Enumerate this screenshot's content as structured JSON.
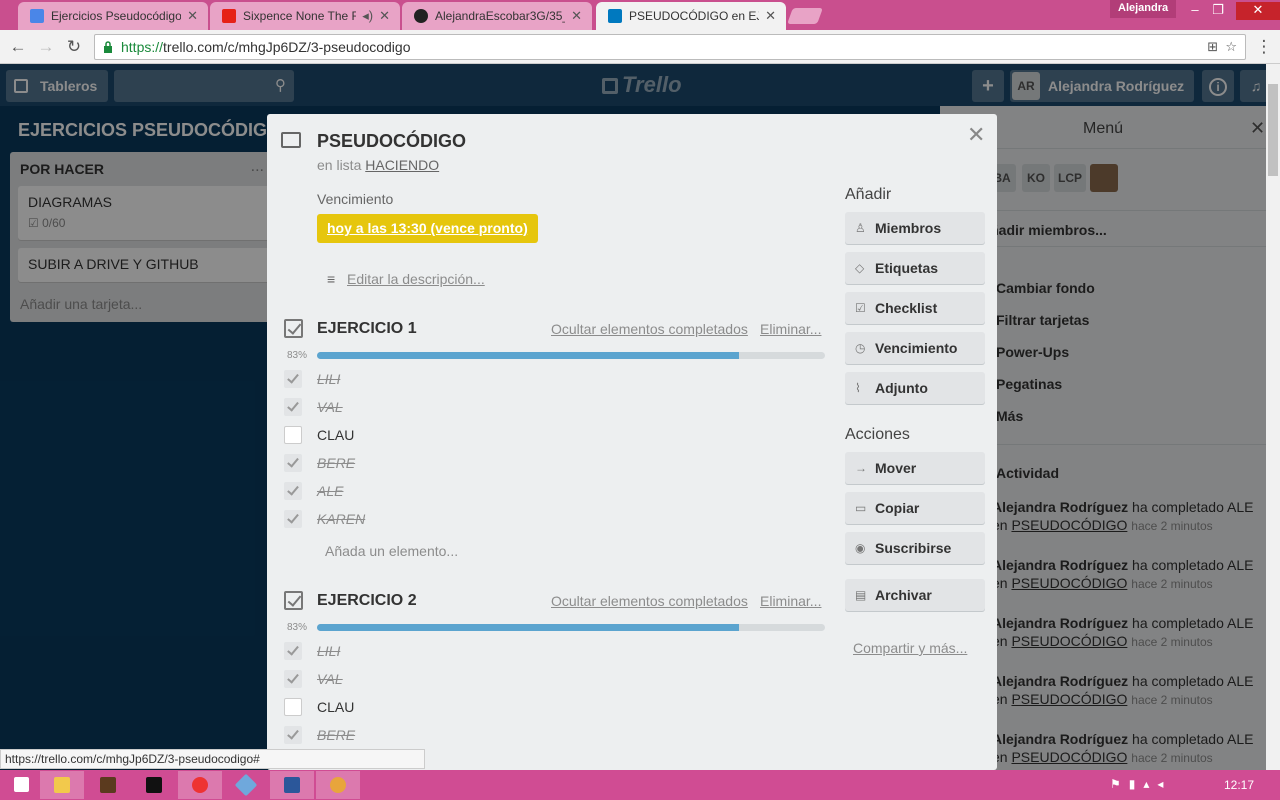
{
  "browser": {
    "tabs": [
      {
        "title": "Ejercicios Pseudocódigo",
        "color": "#4a86e8"
      },
      {
        "title": "Sixpence None The R",
        "color": "#e62117"
      },
      {
        "title": "AlejandraEscobar3G/35_",
        "color": "#222222"
      },
      {
        "title": "PSEUDOCÓDIGO en EJEF",
        "color": "#0079bf"
      }
    ],
    "user": "Alejandra",
    "url_scheme": "https://",
    "url_rest": "trello.com/c/mhgJp6DZ/3-pseudocodigo",
    "status_url": "https://trello.com/c/mhgJp6DZ/3-pseudocodigo#"
  },
  "header": {
    "boards_label": "Tableros",
    "logo": "Trello",
    "add_label": "+",
    "initials": "AR",
    "user_name": "Alejandra Rodríguez",
    "info_label": "i"
  },
  "board": {
    "title": "EJERCICIOS PSEUDOCÓDIGO",
    "list": {
      "name": "POR HACER",
      "menu": "...",
      "cards": [
        {
          "title": "DIAGRAMAS",
          "badge": "0/60"
        },
        {
          "title": "SUBIR A DRIVE Y GITHUB"
        }
      ],
      "add": "Añadir una tarjeta..."
    }
  },
  "menu": {
    "title": "Menú",
    "members": [
      "BA",
      "KO",
      "LCP"
    ],
    "add_members": "Añadir miembros...",
    "items": [
      "Cambiar fondo",
      "Filtrar tarjetas",
      "Power-Ups",
      "Pegatinas",
      "Más"
    ],
    "activity_title": "Actividad",
    "activity": [
      {
        "who": "Alejandra Rodríguez",
        "action": "ha completado ALE",
        "prefix": "en",
        "card": "PSEUDOCÓDIGO",
        "ago": "hace 2 minutos"
      },
      {
        "who": "Alejandra Rodríguez",
        "action": "ha completado ALE",
        "prefix": "en",
        "card": "PSEUDOCÓDIGO",
        "ago": "hace 2 minutos"
      },
      {
        "who": "Alejandra Rodríguez",
        "action": "ha completado ALE",
        "prefix": "en",
        "card": "PSEUDOCÓDIGO",
        "ago": "hace 2 minutos"
      },
      {
        "who": "Alejandra Rodríguez",
        "action": "ha completado ALE",
        "prefix": "en",
        "card": "PSEUDOCÓDIGO",
        "ago": "hace 2 minutos"
      },
      {
        "who": "Alejandra Rodríguez",
        "action": "ha completado ALE",
        "prefix": "en",
        "card": "PSEUDOCÓDIGO",
        "ago": "hace 2 minutos"
      }
    ]
  },
  "modal": {
    "title": "PSEUDOCÓDIGO",
    "in_list_prefix": "en lista",
    "in_list": "HACIENDO",
    "due_label": "Vencimiento",
    "due_value": "hoy a las 13:30 (vence pronto)",
    "desc_link": "Editar la descripción...",
    "checklists": [
      {
        "title": "EJERCICIO 1",
        "hide": "Ocultar elementos completados",
        "delete": "Eliminar...",
        "percent": "83%",
        "progress": 0.83,
        "items": [
          {
            "text": "LILI",
            "done": true
          },
          {
            "text": "VAL",
            "done": true
          },
          {
            "text": "CLAU",
            "done": false
          },
          {
            "text": "BERE",
            "done": true
          },
          {
            "text": "ALE",
            "done": true
          },
          {
            "text": "KAREN",
            "done": true
          }
        ],
        "add": "Añada un elemento..."
      },
      {
        "title": "EJERCICIO 2",
        "hide": "Ocultar elementos completados",
        "delete": "Eliminar...",
        "percent": "83%",
        "progress": 0.83,
        "items": [
          {
            "text": "LILI",
            "done": true
          },
          {
            "text": "VAL",
            "done": true
          },
          {
            "text": "CLAU",
            "done": false
          },
          {
            "text": "BERE",
            "done": true
          }
        ]
      }
    ],
    "add_section": "Añadir",
    "add_buttons": [
      {
        "label": "Miembros",
        "icon": "person-icon",
        "glyph": "♙"
      },
      {
        "label": "Etiquetas",
        "icon": "label-icon",
        "glyph": "◇"
      },
      {
        "label": "Checklist",
        "icon": "checklist-icon",
        "glyph": "☑"
      },
      {
        "label": "Vencimiento",
        "icon": "clock-icon",
        "glyph": "◷"
      },
      {
        "label": "Adjunto",
        "icon": "paperclip-icon",
        "glyph": "⌇"
      }
    ],
    "actions_section": "Acciones",
    "action_buttons": [
      {
        "label": "Mover",
        "icon": "arrow-right-icon",
        "glyph": "→"
      },
      {
        "label": "Copiar",
        "icon": "copy-icon",
        "glyph": "▭"
      },
      {
        "label": "Suscribirse",
        "icon": "eye-icon",
        "glyph": "◉"
      },
      {
        "label": "Archivar",
        "icon": "archive-icon",
        "glyph": "▤"
      }
    ],
    "share": "Compartir y más..."
  },
  "taskbar": {
    "clock": "12:17"
  }
}
